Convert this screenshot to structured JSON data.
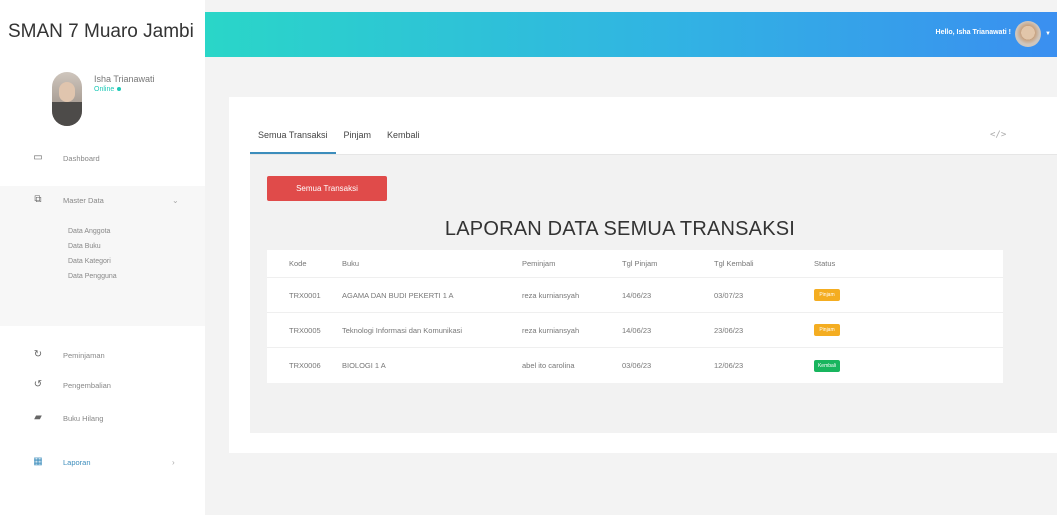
{
  "app": {
    "brand": "SMAN 7 Muaro Jambi"
  },
  "profile": {
    "name": "Isha Trianawati",
    "status": "Online"
  },
  "sidebar": {
    "dashboard": "Dashboard",
    "master_data": "Master Data",
    "master_sub": [
      "Data Anggota",
      "Data Buku",
      "Data Kategori",
      "Data Pengguna"
    ],
    "peminjaman": "Peminjaman",
    "pengembalian": "Pengembalian",
    "buku_hilang": "Buku Hilang",
    "laporan": "Laporan"
  },
  "topbar": {
    "greeting": "Hello, Isha Trianawati !"
  },
  "tabs": [
    "Semua Transaksi",
    "Pinjam",
    "Kembali"
  ],
  "code_icon": "</>",
  "button": {
    "label": "Semua Transaksi"
  },
  "report": {
    "title": "LAPORAN DATA SEMUA TRANSAKSI"
  },
  "table": {
    "headers": [
      "Kode",
      "Buku",
      "Peminjam",
      "Tgl Pinjam",
      "Tgl Kembali",
      "Status"
    ],
    "rows": [
      {
        "kode": "TRX0001",
        "buku": "AGAMA DAN BUDI PEKERTI 1 A",
        "peminjam": "reza kurniansyah",
        "tgl_pinjam": "14/06/23",
        "tgl_kembali": "03/07/23",
        "status": "Pinjam"
      },
      {
        "kode": "TRX0005",
        "buku": "Teknologi Informasi dan Komunikasi",
        "peminjam": "reza kurniansyah",
        "tgl_pinjam": "14/06/23",
        "tgl_kembali": "23/06/23",
        "status": "Pinjam"
      },
      {
        "kode": "TRX0006",
        "buku": "BIOLOGI 1 A",
        "peminjam": "abel ito carolina",
        "tgl_pinjam": "03/06/23",
        "tgl_kembali": "12/06/23",
        "status": "Kembali"
      }
    ]
  },
  "colors": {
    "accent": "#3c8dbc",
    "danger": "#e04b4a",
    "warning": "#f4ad21",
    "success": "#18b55e"
  }
}
